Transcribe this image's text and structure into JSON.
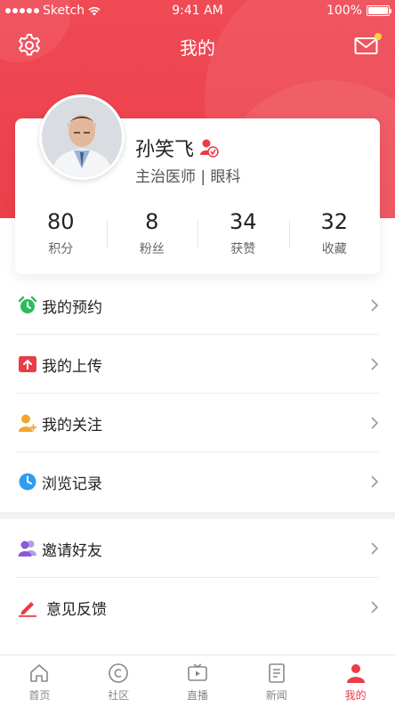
{
  "status_bar": {
    "carrier": "Sketch",
    "time": "9:41 AM",
    "battery": "100%"
  },
  "header": {
    "title": "我的",
    "settings_icon": "gear-icon",
    "message_icon": "mail-icon",
    "accent": "#ec3f4a"
  },
  "profile": {
    "name": "孙笑飞",
    "subtitle": "主治医师 | 眼科",
    "verified_icon": "verified-doctor-icon",
    "stats": [
      {
        "value": "80",
        "label": "积分"
      },
      {
        "value": "8",
        "label": "粉丝"
      },
      {
        "value": "34",
        "label": "获赞"
      },
      {
        "value": "32",
        "label": "收藏"
      }
    ]
  },
  "menu_group_1": [
    {
      "label": "我的预约",
      "icon": "alarm-clock-icon",
      "color": "#2dbb5b"
    },
    {
      "label": "我的上传",
      "icon": "upload-box-icon",
      "color": "#ea3b46"
    },
    {
      "label": "我的关注",
      "icon": "user-follow-icon",
      "color": "#f4a62a"
    },
    {
      "label": "浏览记录",
      "icon": "clock-icon",
      "color": "#2f9cf0"
    }
  ],
  "menu_group_2": [
    {
      "label": "邀请好友",
      "icon": "users-icon",
      "color": "#8a5ad8"
    },
    {
      "label": "意见反馈",
      "icon": "pen-icon",
      "color": "#ea3b46"
    }
  ],
  "tabbar": [
    {
      "label": "首页",
      "icon": "home-icon"
    },
    {
      "label": "社区",
      "icon": "community-icon"
    },
    {
      "label": "直播",
      "icon": "live-tv-icon"
    },
    {
      "label": "新闻",
      "icon": "news-icon"
    },
    {
      "label": "我的",
      "icon": "profile-icon",
      "active": true
    }
  ]
}
